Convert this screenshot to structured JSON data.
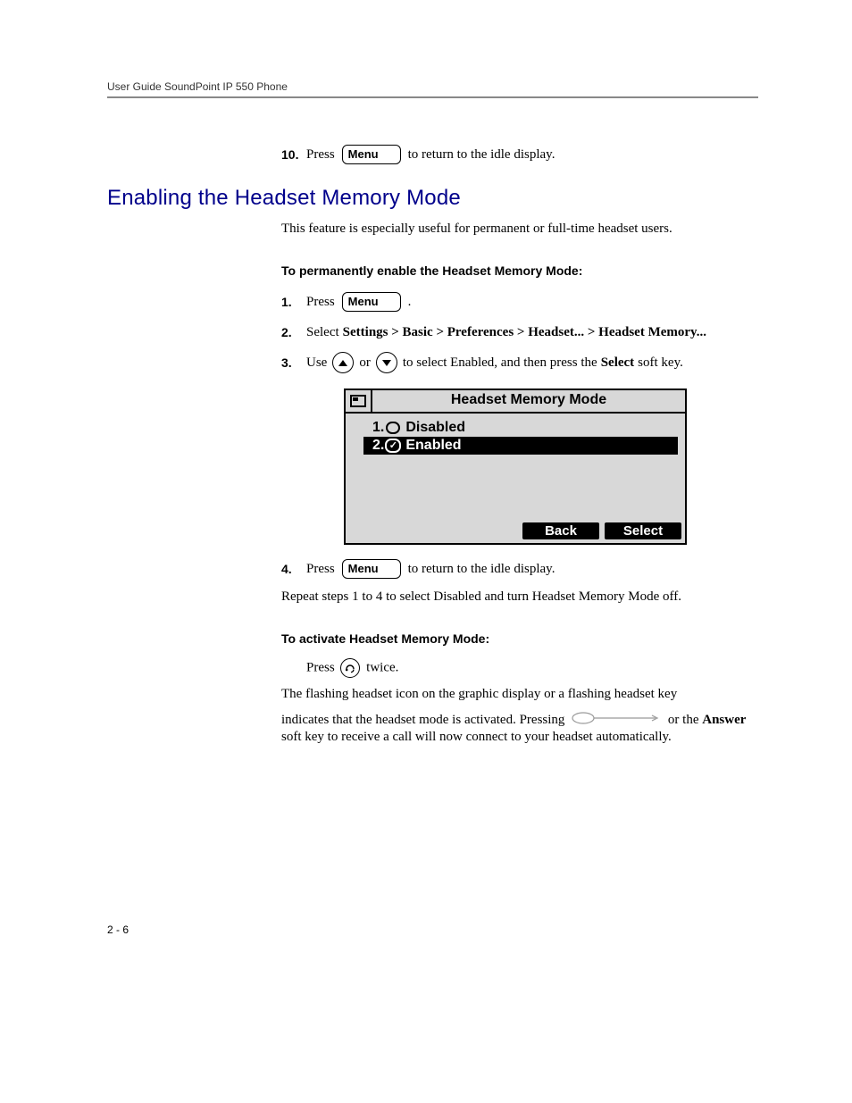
{
  "header": {
    "running_head": "User Guide SoundPoint IP 550 Phone"
  },
  "prev_section_tail": {
    "step_num": "10.",
    "press": "Press",
    "menu_label": "Menu",
    "tail": "to return to the idle display."
  },
  "section": {
    "title": "Enabling the Headset Memory Mode",
    "intro": "This feature is especially useful for permanent or full-time headset users."
  },
  "enable_proc": {
    "heading": "To permanently enable the Headset Memory Mode:",
    "steps": [
      {
        "num": "1.",
        "press": "Press",
        "menu_label": "Menu",
        "tail": "."
      },
      {
        "num": "2.",
        "lead": "Select ",
        "path": "Settings > Basic > Preferences > Headset... > Headset Memory..."
      },
      {
        "num": "3.",
        "lead": "Use ",
        "mid": " or ",
        "tail1": " to select Enabled, and then press the ",
        "select": "Select",
        "tail2": " soft key."
      },
      {
        "num": "4.",
        "press": "Press",
        "menu_label": "Menu",
        "tail": "to return to the idle display."
      }
    ],
    "repeat": "Repeat steps 1 to 4 to select Disabled and turn Headset Memory Mode off."
  },
  "phone_screen": {
    "title": "Headset Memory Mode",
    "rows": [
      {
        "idx": "1.",
        "label": "Disabled",
        "selected": false
      },
      {
        "idx": "2.",
        "label": "Enabled",
        "selected": true
      }
    ],
    "softkeys": {
      "back": "Back",
      "select": "Select"
    }
  },
  "activate_proc": {
    "heading": "To activate Headset Memory Mode:",
    "press": "Press ",
    "twice": " twice.",
    "line1": "The flashing headset icon on the graphic display or a flashing headset key",
    "line2a": "indicates that the headset mode is activated. Pressing ",
    "line2b": " or the ",
    "answer": "Answer",
    "line2c": " soft key to receive a call will now connect to your headset automatically."
  },
  "footer": {
    "page": "2 - 6"
  }
}
